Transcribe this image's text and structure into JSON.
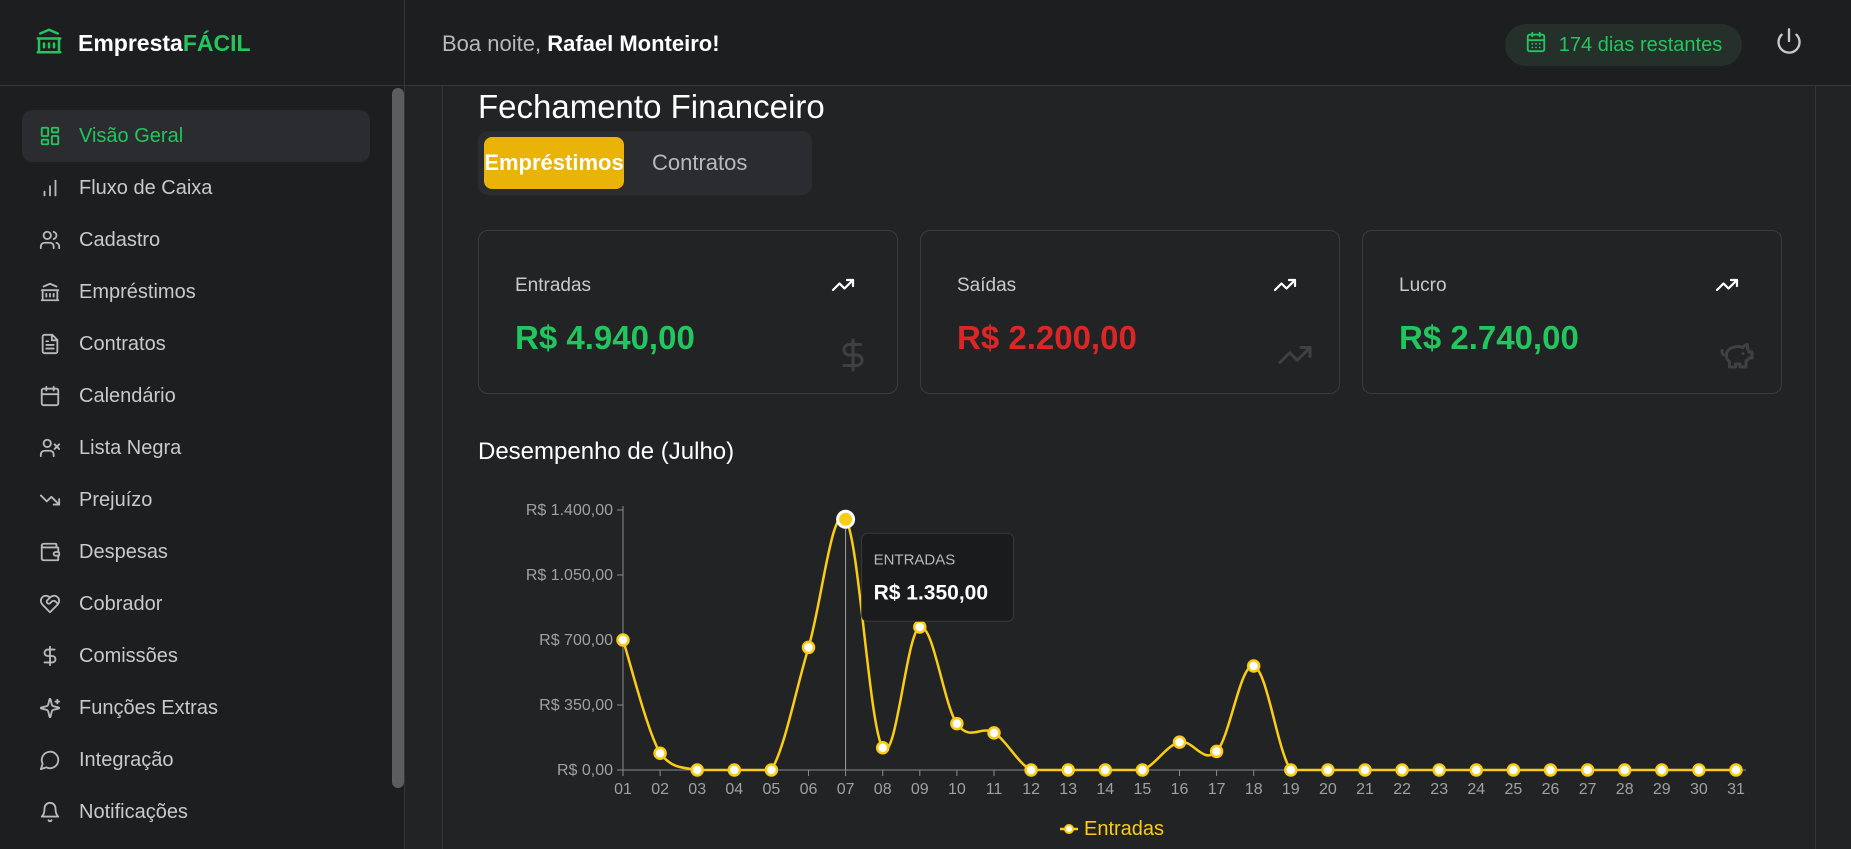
{
  "brand": {
    "name": "Empresta",
    "accent": "FÁCIL"
  },
  "header": {
    "greeting": "Boa noite,",
    "user_name": "Rafael Monteiro!",
    "days_left": "174 dias restantes"
  },
  "sidebar": {
    "items": [
      {
        "label": "Visão Geral",
        "icon": "dashboard-icon",
        "active": true
      },
      {
        "label": "Fluxo de Caixa",
        "icon": "bar-chart-icon"
      },
      {
        "label": "Cadastro",
        "icon": "users-icon"
      },
      {
        "label": "Empréstimos",
        "icon": "bank-icon"
      },
      {
        "label": "Contratos",
        "icon": "document-icon"
      },
      {
        "label": "Calendário",
        "icon": "calendar-icon"
      },
      {
        "label": "Lista Negra",
        "icon": "user-x-icon"
      },
      {
        "label": "Prejuízo",
        "icon": "trending-down-icon"
      },
      {
        "label": "Despesas",
        "icon": "wallet-icon"
      },
      {
        "label": "Cobrador",
        "icon": "handshake-heart-icon"
      },
      {
        "label": "Comissões",
        "icon": "dollar-icon"
      },
      {
        "label": "Funções Extras",
        "icon": "sparkles-icon"
      },
      {
        "label": "Integração",
        "icon": "chat-icon"
      },
      {
        "label": "Notificações",
        "icon": "bell-icon"
      }
    ]
  },
  "main": {
    "title": "Fechamento Financeiro",
    "tabs": [
      {
        "label": "Empréstimos",
        "active": true
      },
      {
        "label": "Contratos"
      }
    ],
    "cards": [
      {
        "label": "Entradas",
        "value": "R$ 4.940,00",
        "color": "#22c55e",
        "ghost_icon": "dollar-icon"
      },
      {
        "label": "Saídas",
        "value": "R$ 2.200,00",
        "color": "#dc2626",
        "ghost_icon": "trending-up-icon"
      },
      {
        "label": "Lucro",
        "value": "R$ 2.740,00",
        "color": "#22c55e",
        "ghost_icon": "piggy-bank-icon"
      }
    ],
    "chart_title": "Desempenho de (Julho)"
  },
  "chart_data": {
    "type": "line",
    "title": "Desempenho de (Julho)",
    "categories": [
      "01",
      "02",
      "03",
      "04",
      "05",
      "06",
      "07",
      "08",
      "09",
      "10",
      "11",
      "12",
      "13",
      "14",
      "15",
      "16",
      "17",
      "18",
      "19",
      "20",
      "21",
      "22",
      "23",
      "24",
      "25",
      "26",
      "27",
      "28",
      "29",
      "30",
      "31"
    ],
    "series": [
      {
        "name": "Entradas",
        "color": "#facc15",
        "values": [
          700,
          90,
          0,
          0,
          0,
          660,
          1350,
          120,
          770,
          250,
          200,
          0,
          0,
          0,
          0,
          150,
          100,
          560,
          0,
          0,
          0,
          0,
          0,
          0,
          0,
          0,
          0,
          0,
          0,
          0,
          0
        ]
      }
    ],
    "ylim": [
      0,
      1400
    ],
    "yticks": [
      "R$ 0,00",
      "R$ 350,00",
      "R$ 700,00",
      "R$ 1.050,00",
      "R$ 1.400,00"
    ],
    "ytick_values": [
      0,
      350,
      700,
      1050,
      1400
    ],
    "legend": "bottom",
    "tooltip": {
      "index": 6,
      "label": "ENTRADAS",
      "value": "R$ 1.350,00"
    }
  },
  "colors": {
    "accent_green": "#22c55e",
    "accent_yellow": "#eab308",
    "negative_red": "#dc2626",
    "background": "#222325",
    "panel": "#1d1e20"
  }
}
